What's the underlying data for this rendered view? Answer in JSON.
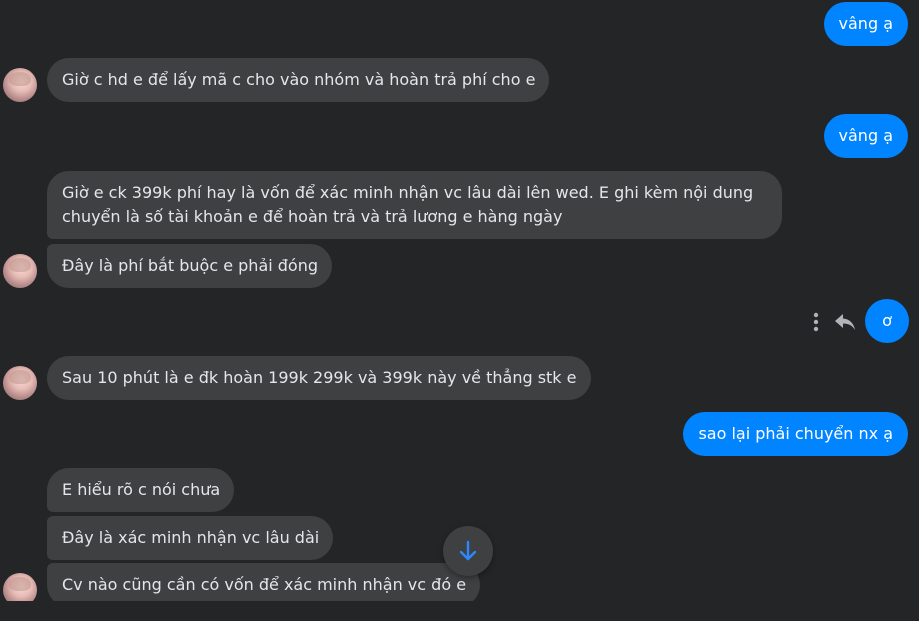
{
  "colors": {
    "background": "#242526",
    "incoming_bubble": "#3e4042",
    "outgoing_bubble": "#0084ff",
    "text": "#e4e6eb"
  },
  "messages": [
    {
      "direction": "out",
      "text": "vâng ạ"
    },
    {
      "direction": "in",
      "text": "Giờ c hd e để lấy mã c cho vào nhóm và hoàn trả phí cho e"
    },
    {
      "direction": "out",
      "text": "vâng ạ"
    },
    {
      "direction": "in",
      "text": "Giờ e ck 399k phí hay là vốn để xác minh nhận vc lâu dài lên wed. E ghi kèm nội dung chuyển là số tài khoản e để hoàn trả và trả lương e hàng ngày"
    },
    {
      "direction": "in",
      "text": "Đây là phí bắt buộc e phải đóng"
    },
    {
      "direction": "out",
      "text": "ơ"
    },
    {
      "direction": "in",
      "text": "Sau 10 phút là e đk hoàn 199k 299k và 399k này về thẳng stk e"
    },
    {
      "direction": "out",
      "text": "sao lại phải chuyển nx ạ"
    },
    {
      "direction": "in",
      "text": "E hiểu rõ c nói chưa"
    },
    {
      "direction": "in",
      "text": "Đây là xác minh nhận vc lâu dài"
    },
    {
      "direction": "in",
      "text": "Cv nào cũng cần có vốn để xác minh nhận vc đó e"
    }
  ],
  "icons": {
    "more": "more-vertical-icon",
    "reply": "reply-icon",
    "scroll_down": "arrow-down-icon",
    "avatar": "contact-avatar"
  }
}
